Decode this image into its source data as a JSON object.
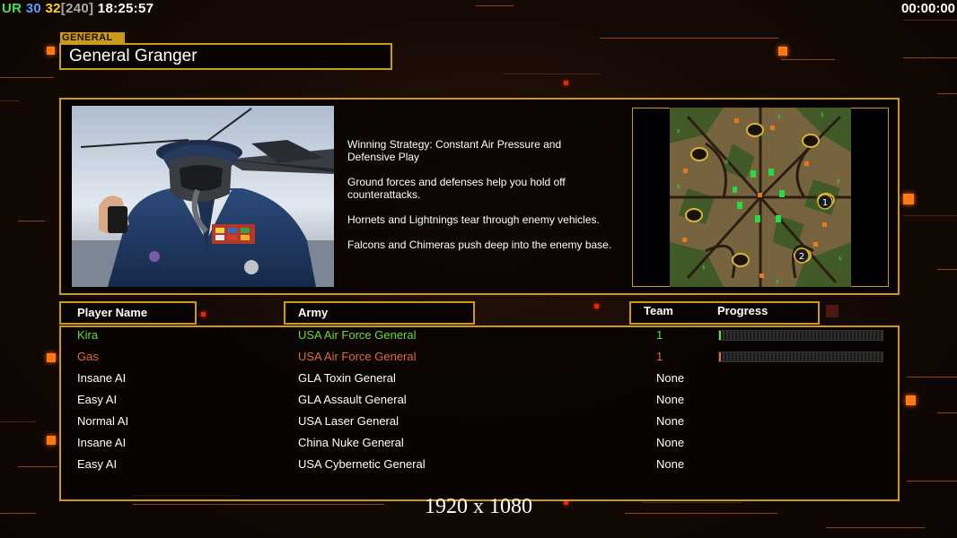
{
  "hud": {
    "ur": "UR",
    "num_a": "30",
    "num_b": "32",
    "num_c": "[240]",
    "clock": "18:25:57",
    "game_time": "00:00:00"
  },
  "general": {
    "tag": "GENERAL",
    "name": "General Granger",
    "strategy": [
      "Winning Strategy: Constant Air Pressure and\n Defensive Play",
      "Ground forces and defenses help you hold off\n counterattacks.",
      "Hornets and Lightnings tear through enemy vehicles.",
      "Falcons and Chimeras push deep into the enemy base."
    ]
  },
  "minimap": {
    "markers": [
      "1",
      "2"
    ]
  },
  "table": {
    "headers": {
      "player": "Player Name",
      "army": "Army",
      "team": "Team",
      "progress": "Progress"
    },
    "rows": [
      {
        "name": "Kira",
        "army": "USA Air Force General",
        "team": "1",
        "color": "#6fd83a",
        "progress": 0.01
      },
      {
        "name": "Gas",
        "army": "USA Air Force General",
        "team": "1",
        "color": "#e06a4a",
        "progress": 0.005
      },
      {
        "name": "Insane AI",
        "army": "GLA Toxin General",
        "team": "None",
        "color": "#ffffff"
      },
      {
        "name": "Easy AI",
        "army": "GLA Assault General",
        "team": "None",
        "color": "#ffffff"
      },
      {
        "name": "Normal AI",
        "army": "USA Laser General",
        "team": "None",
        "color": "#ffffff"
      },
      {
        "name": "Insane AI",
        "army": "China Nuke General",
        "team": "None",
        "color": "#ffffff"
      },
      {
        "name": "Easy AI",
        "army": "USA Cybernetic General",
        "team": "None",
        "color": "#ffffff"
      }
    ]
  },
  "resolution": "1920 x 1080",
  "colors": {
    "accent_gold": "#c99a1c",
    "trace_orange": "#b85a12"
  }
}
